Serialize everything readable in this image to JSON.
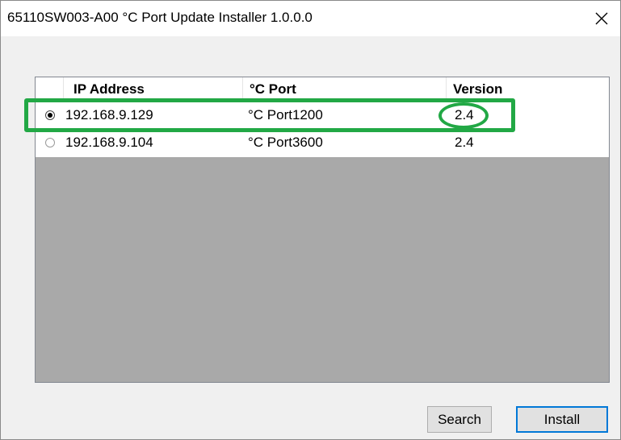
{
  "window": {
    "title": "65110SW003-A00 °C Port Update Installer 1.0.0.0",
    "close_glyph": "✕"
  },
  "table": {
    "columns": [
      "IP Address",
      "°C Port",
      "Version"
    ],
    "rows": [
      {
        "selected": true,
        "ip": "192.168.9.129",
        "port": "°C Port1200",
        "version": "2.4"
      },
      {
        "selected": false,
        "ip": "192.168.9.104",
        "port": "°C Port3600",
        "version": "2.4"
      }
    ]
  },
  "buttons": {
    "search": "Search",
    "install": "Install"
  },
  "colors": {
    "highlight": "#22a845",
    "focus_border": "#0078d7",
    "list_background": "#a9a9a9"
  },
  "icons": {
    "close": "close-icon"
  }
}
